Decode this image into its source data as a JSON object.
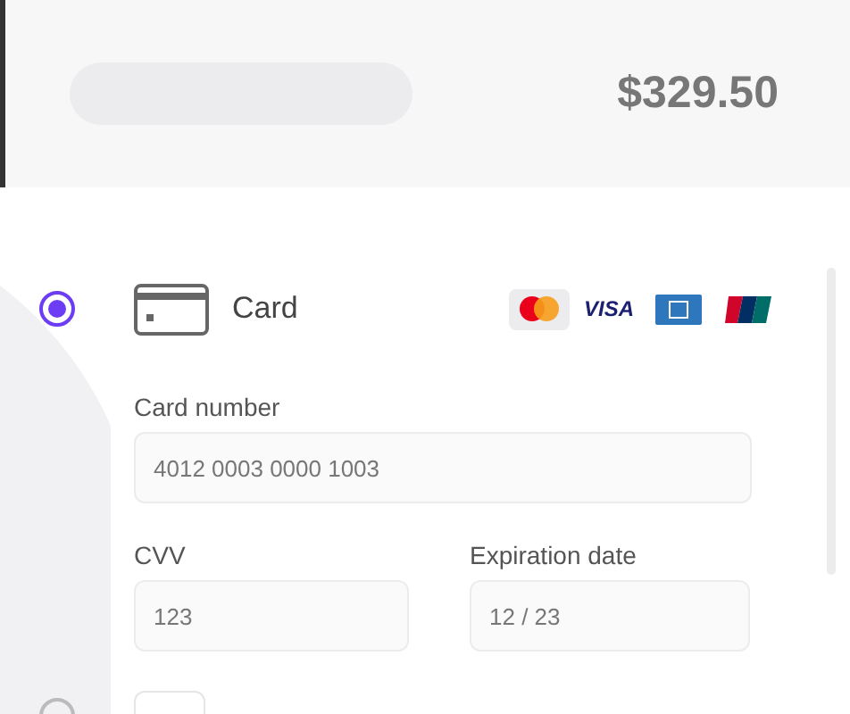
{
  "header": {
    "total": "$329.50"
  },
  "payment_methods": [
    {
      "kind": "card",
      "label": "Card",
      "selected": true,
      "brands": [
        {
          "kind": "mastercard",
          "selected": true
        },
        {
          "kind": "visa",
          "label": "VISA",
          "selected": false
        },
        {
          "kind": "amex",
          "selected": false
        },
        {
          "kind": "unionpay",
          "selected": false
        }
      ],
      "fields": [
        {
          "label": "Card number",
          "value": "4012 0003 0000 1003"
        },
        {
          "label": "CVV",
          "value": "123"
        },
        {
          "label": "Expiration date",
          "value": "12 / 23"
        }
      ]
    },
    {
      "kind": "other",
      "selected": false
    }
  ]
}
